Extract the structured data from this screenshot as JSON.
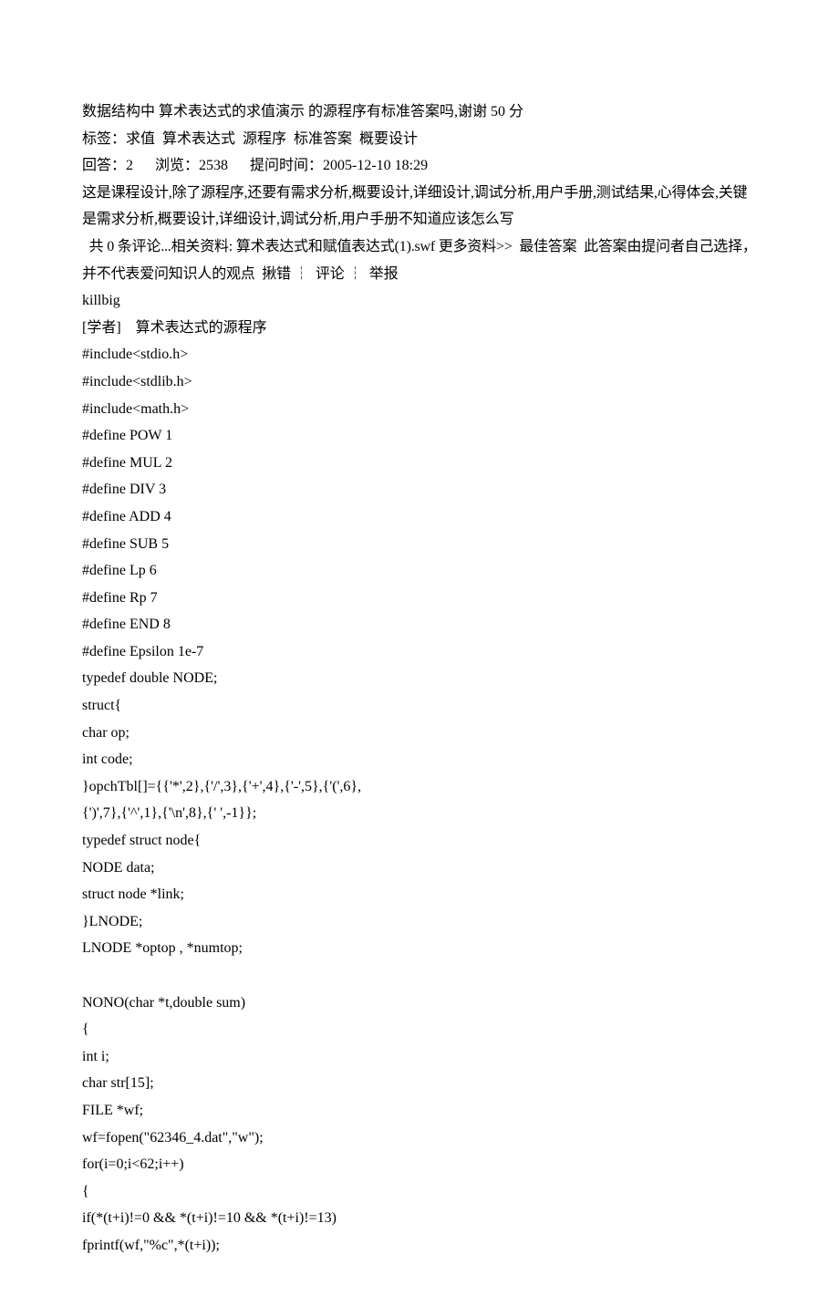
{
  "lines": [
    "数据结构中 算术表达式的求值演示 的源程序有标准答案吗,谢谢 50 分",
    "标签：求值  算术表达式  源程序  标准答案  概要设计",
    "回答：2      浏览：2538      提问时间：2005-12-10 18:29",
    "这是课程设计,除了源程序,还要有需求分析,概要设计,详细设计,调试分析,用户手册,测试结果,心得体会,关键是需求分析,概要设计,详细设计,调试分析,用户手册不知道应该怎么写",
    "  共 0 条评论...相关资料: 算术表达式和赋值表达式(1).swf 更多资料>>  最佳答案  此答案由提问者自己选择，并不代表爱问知识人的观点  揪错 ┆  评论 ┆  举报",
    "killbig",
    "[学者]    算术表达式的源程序",
    "#include<stdio.h>",
    "#include<stdlib.h>",
    "#include<math.h>",
    "#define POW 1",
    "#define MUL 2",
    "#define DIV 3",
    "#define ADD 4",
    "#define SUB 5",
    "#define Lp 6",
    "#define Rp 7",
    "#define END 8",
    "#define Epsilon 1e-7",
    "typedef double NODE;",
    "struct{",
    "char op;",
    "int code;",
    "}opchTbl[]={{'*',2},{'/',3},{'+',4},{'-',5},{'(',6},",
    "{')',7},{'^',1},{'\\n',8},{' ',-1}};",
    "typedef struct node{",
    "NODE data;",
    "struct node *link;",
    "}LNODE;",
    "LNODE *optop , *numtop;",
    "",
    "NONO(char *t,double sum)",
    "{",
    "int i;",
    "char str[15];",
    "FILE *wf;",
    "wf=fopen(\"62346_4.dat\",\"w\");",
    "for(i=0;i<62;i++)",
    "{",
    "if(*(t+i)!=0 && *(t+i)!=10 && *(t+i)!=13)",
    "fprintf(wf,\"%c\",*(t+i));"
  ]
}
